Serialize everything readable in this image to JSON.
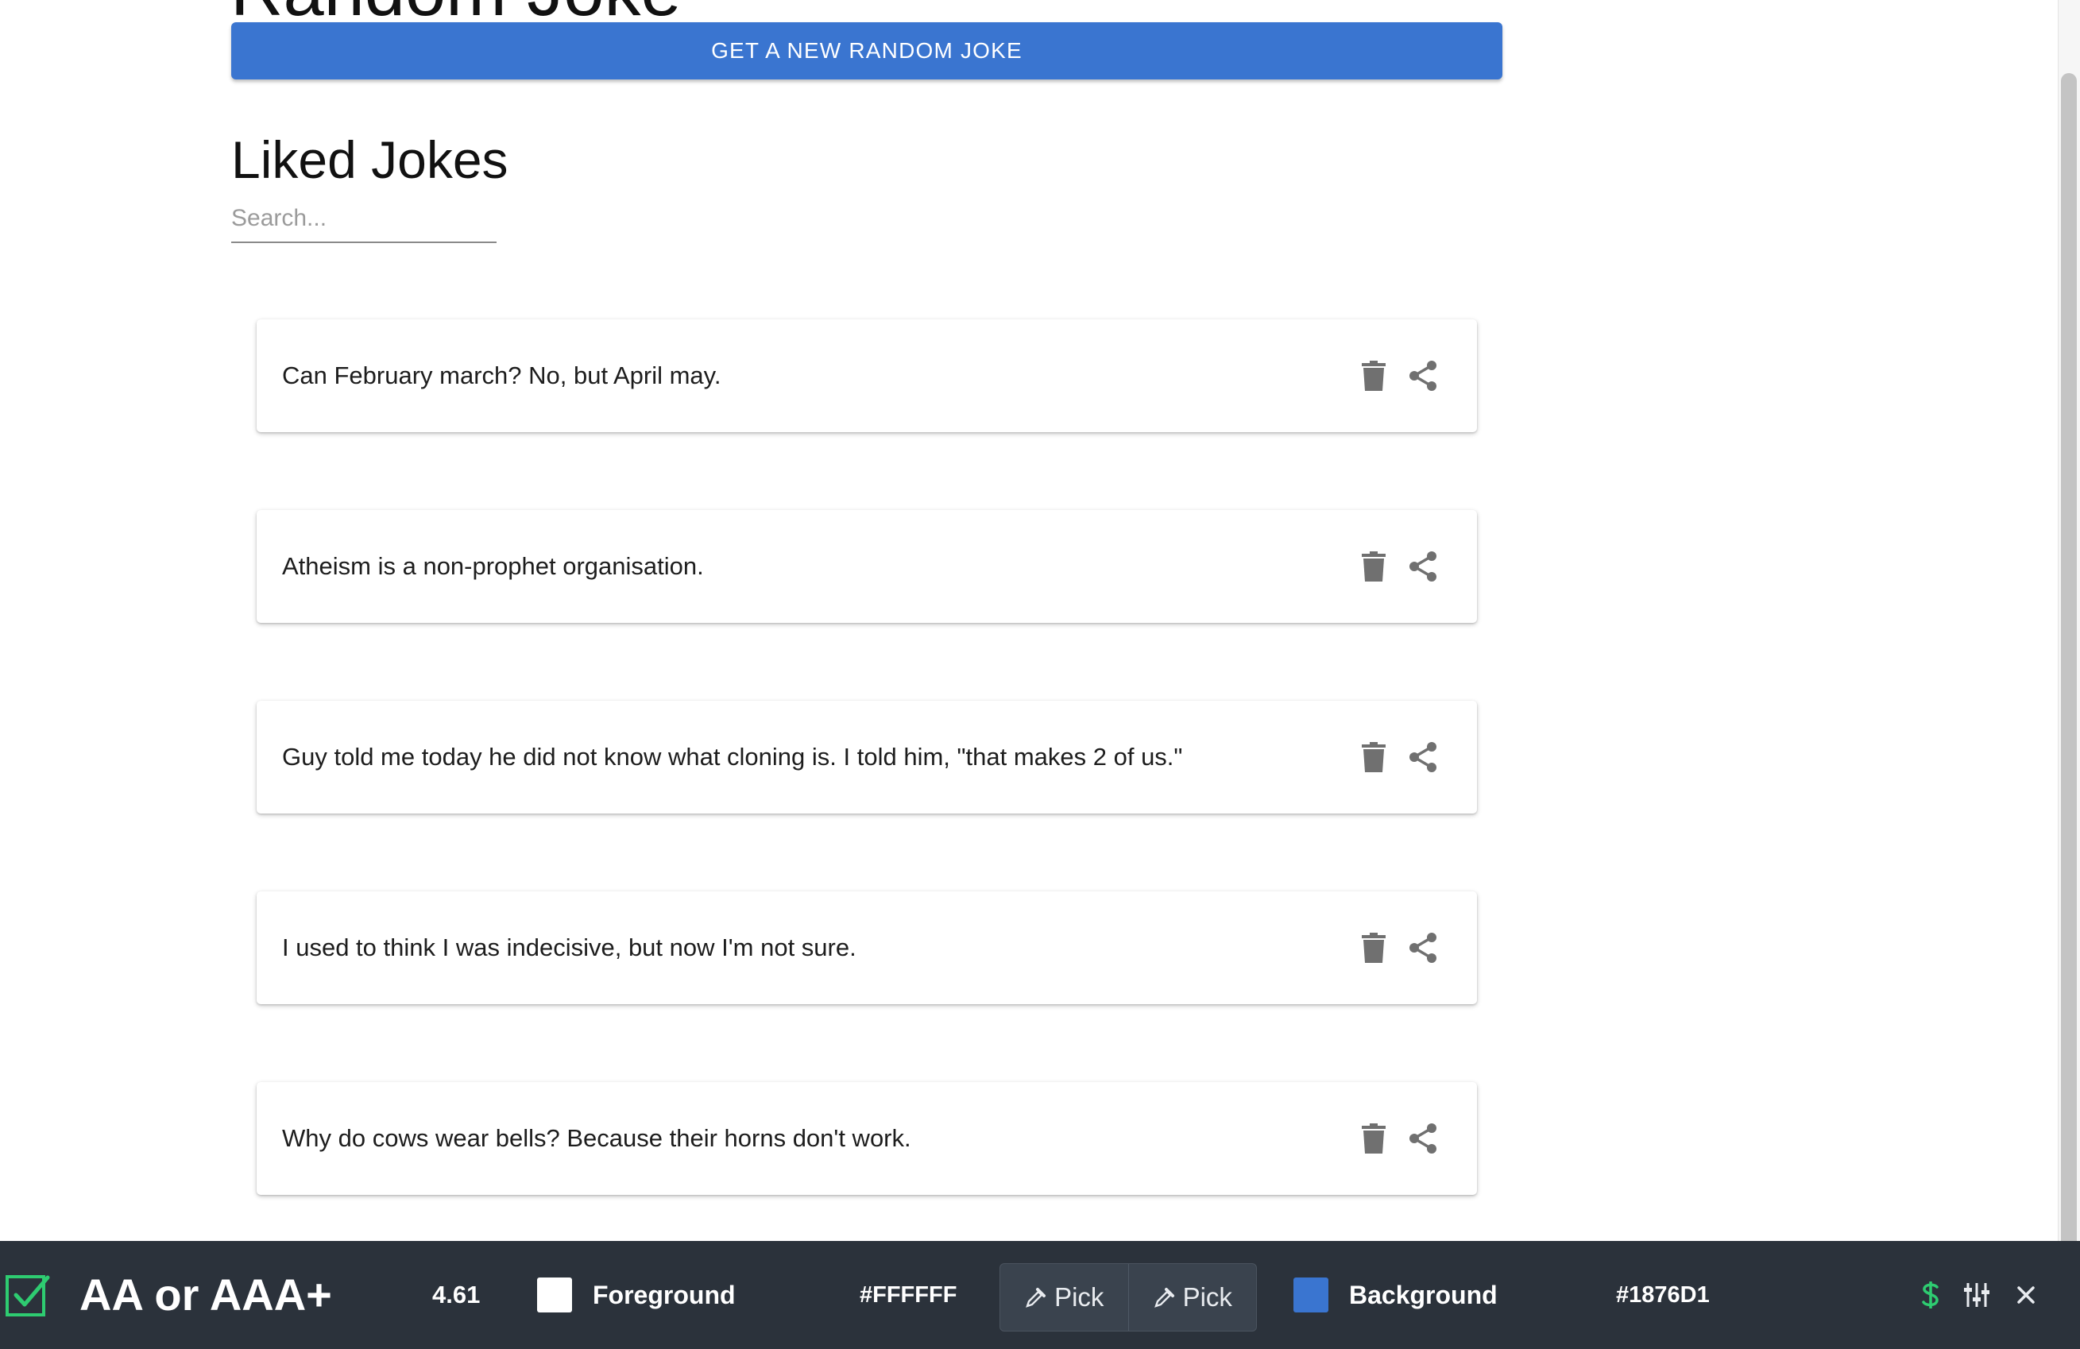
{
  "header": {
    "title": "Random Joke",
    "new_joke_button": "GET A NEW RANDOM JOKE"
  },
  "liked": {
    "title": "Liked Jokes",
    "search_placeholder": "Search...",
    "jokes": [
      "Can February march? No, but April may.",
      "Atheism is a non-prophet organisation.",
      "Guy told me today he did not know what cloning is. I told him, \"that makes 2 of us.\"",
      "I used to think I was indecisive, but now I'm not sure.",
      "Why do cows wear bells? Because their horns don't work."
    ]
  },
  "contrast_toolbar": {
    "level": "AA or AAA+",
    "ratio": "4.61",
    "foreground_label": "Foreground",
    "foreground_hex": "#FFFFFF",
    "pick_label_1": "Pick",
    "pick_label_2": "Pick",
    "background_label": "Background",
    "background_hex": "#1876D1"
  },
  "colors": {
    "button_blue": "#3a75d0",
    "toolbar_bg": "#2b323b",
    "pass_green": "#2ecc71",
    "icon_gray": "#707070",
    "foreground_swatch": "#ffffff",
    "background_swatch": "#3a75d0"
  }
}
